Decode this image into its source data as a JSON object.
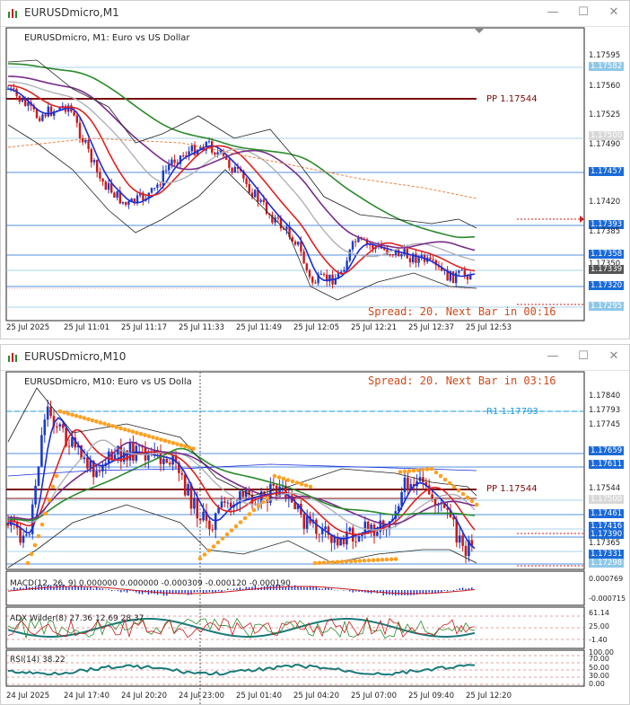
{
  "window1": {
    "title": "EURUSDmicro,M1",
    "header": "EURUSDmicro, M1:  Euro vs US Dollar",
    "pp_label": "PP 1.17544",
    "spread_label": "Spread: 20. Next Bar in 00:16",
    "y_ticks": [
      "1.17595",
      "1.17582",
      "1.17560",
      "1.17525",
      "1.17500",
      "1.17490",
      "1.17457",
      "1.17420",
      "1.17393",
      "1.17385",
      "1.17358",
      "1.17350",
      "1.17339",
      "1.17320",
      "1.17295"
    ],
    "x_ticks": [
      "25 Jul 2025",
      "25 Jul 11:01",
      "25 Jul 11:17",
      "25 Jul 11:33",
      "25 Jul 11:49",
      "25 Jul 12:05",
      "25 Jul 12:21",
      "25 Jul 12:37",
      "25 Jul 12:53"
    ]
  },
  "window2": {
    "title": "EURUSDmicro,M10",
    "header": "EURUSDmicro, M10:  Euro vs US Dolla",
    "r1_label": "R1 1.17793",
    "pp_label": "PP 1.17544",
    "spread_label": "Spread: 20. Next Bar in 03:16",
    "y_ticks": [
      "1.17840",
      "1.17793",
      "1.17745",
      "1.17659",
      "1.17611",
      "1.17544",
      "1.17500",
      "1.17461",
      "1.17416",
      "1.17390",
      "1.17365",
      "1.17331",
      "1.17298"
    ],
    "macd_label": "MACD(12, 26, 9) 0.000000 0.000000 -0.000309 -0.000120 -0.000190",
    "macd_ticks": [
      "0.000769",
      "-0.000715"
    ],
    "adx_label": "ADX Wilder(8) 27.36 12.69 28.37",
    "adx_ticks": [
      "61.14",
      "25.00",
      "-1.40"
    ],
    "rsi_label": "RSI(14) 38.22",
    "rsi_ticks": [
      "100.00",
      "70.00",
      "50.00",
      "30.00",
      "0.00"
    ],
    "x_ticks": [
      "24 Jul 2025",
      "24 Jul 17:40",
      "24 Jul 20:20",
      "24 Jul 23:00",
      "25 Jul 01:40",
      "25 Jul 04:20",
      "25 Jul 07:00",
      "25 Jul 09:40",
      "25 Jul 12:20"
    ]
  },
  "controls": {
    "minimize": "—",
    "maximize": "☐",
    "close": "✕"
  },
  "colors": {
    "up": "#1a3cc8",
    "down": "#c81a1a",
    "pp": "#7a0c0c",
    "grid": "#8ec8e8",
    "ma_green": "#2b8a2b",
    "ma_purple": "#7a2c8a",
    "ma_red": "#e02020",
    "ma_blue": "#1a2cd8",
    "sar": "#ffa020"
  }
}
